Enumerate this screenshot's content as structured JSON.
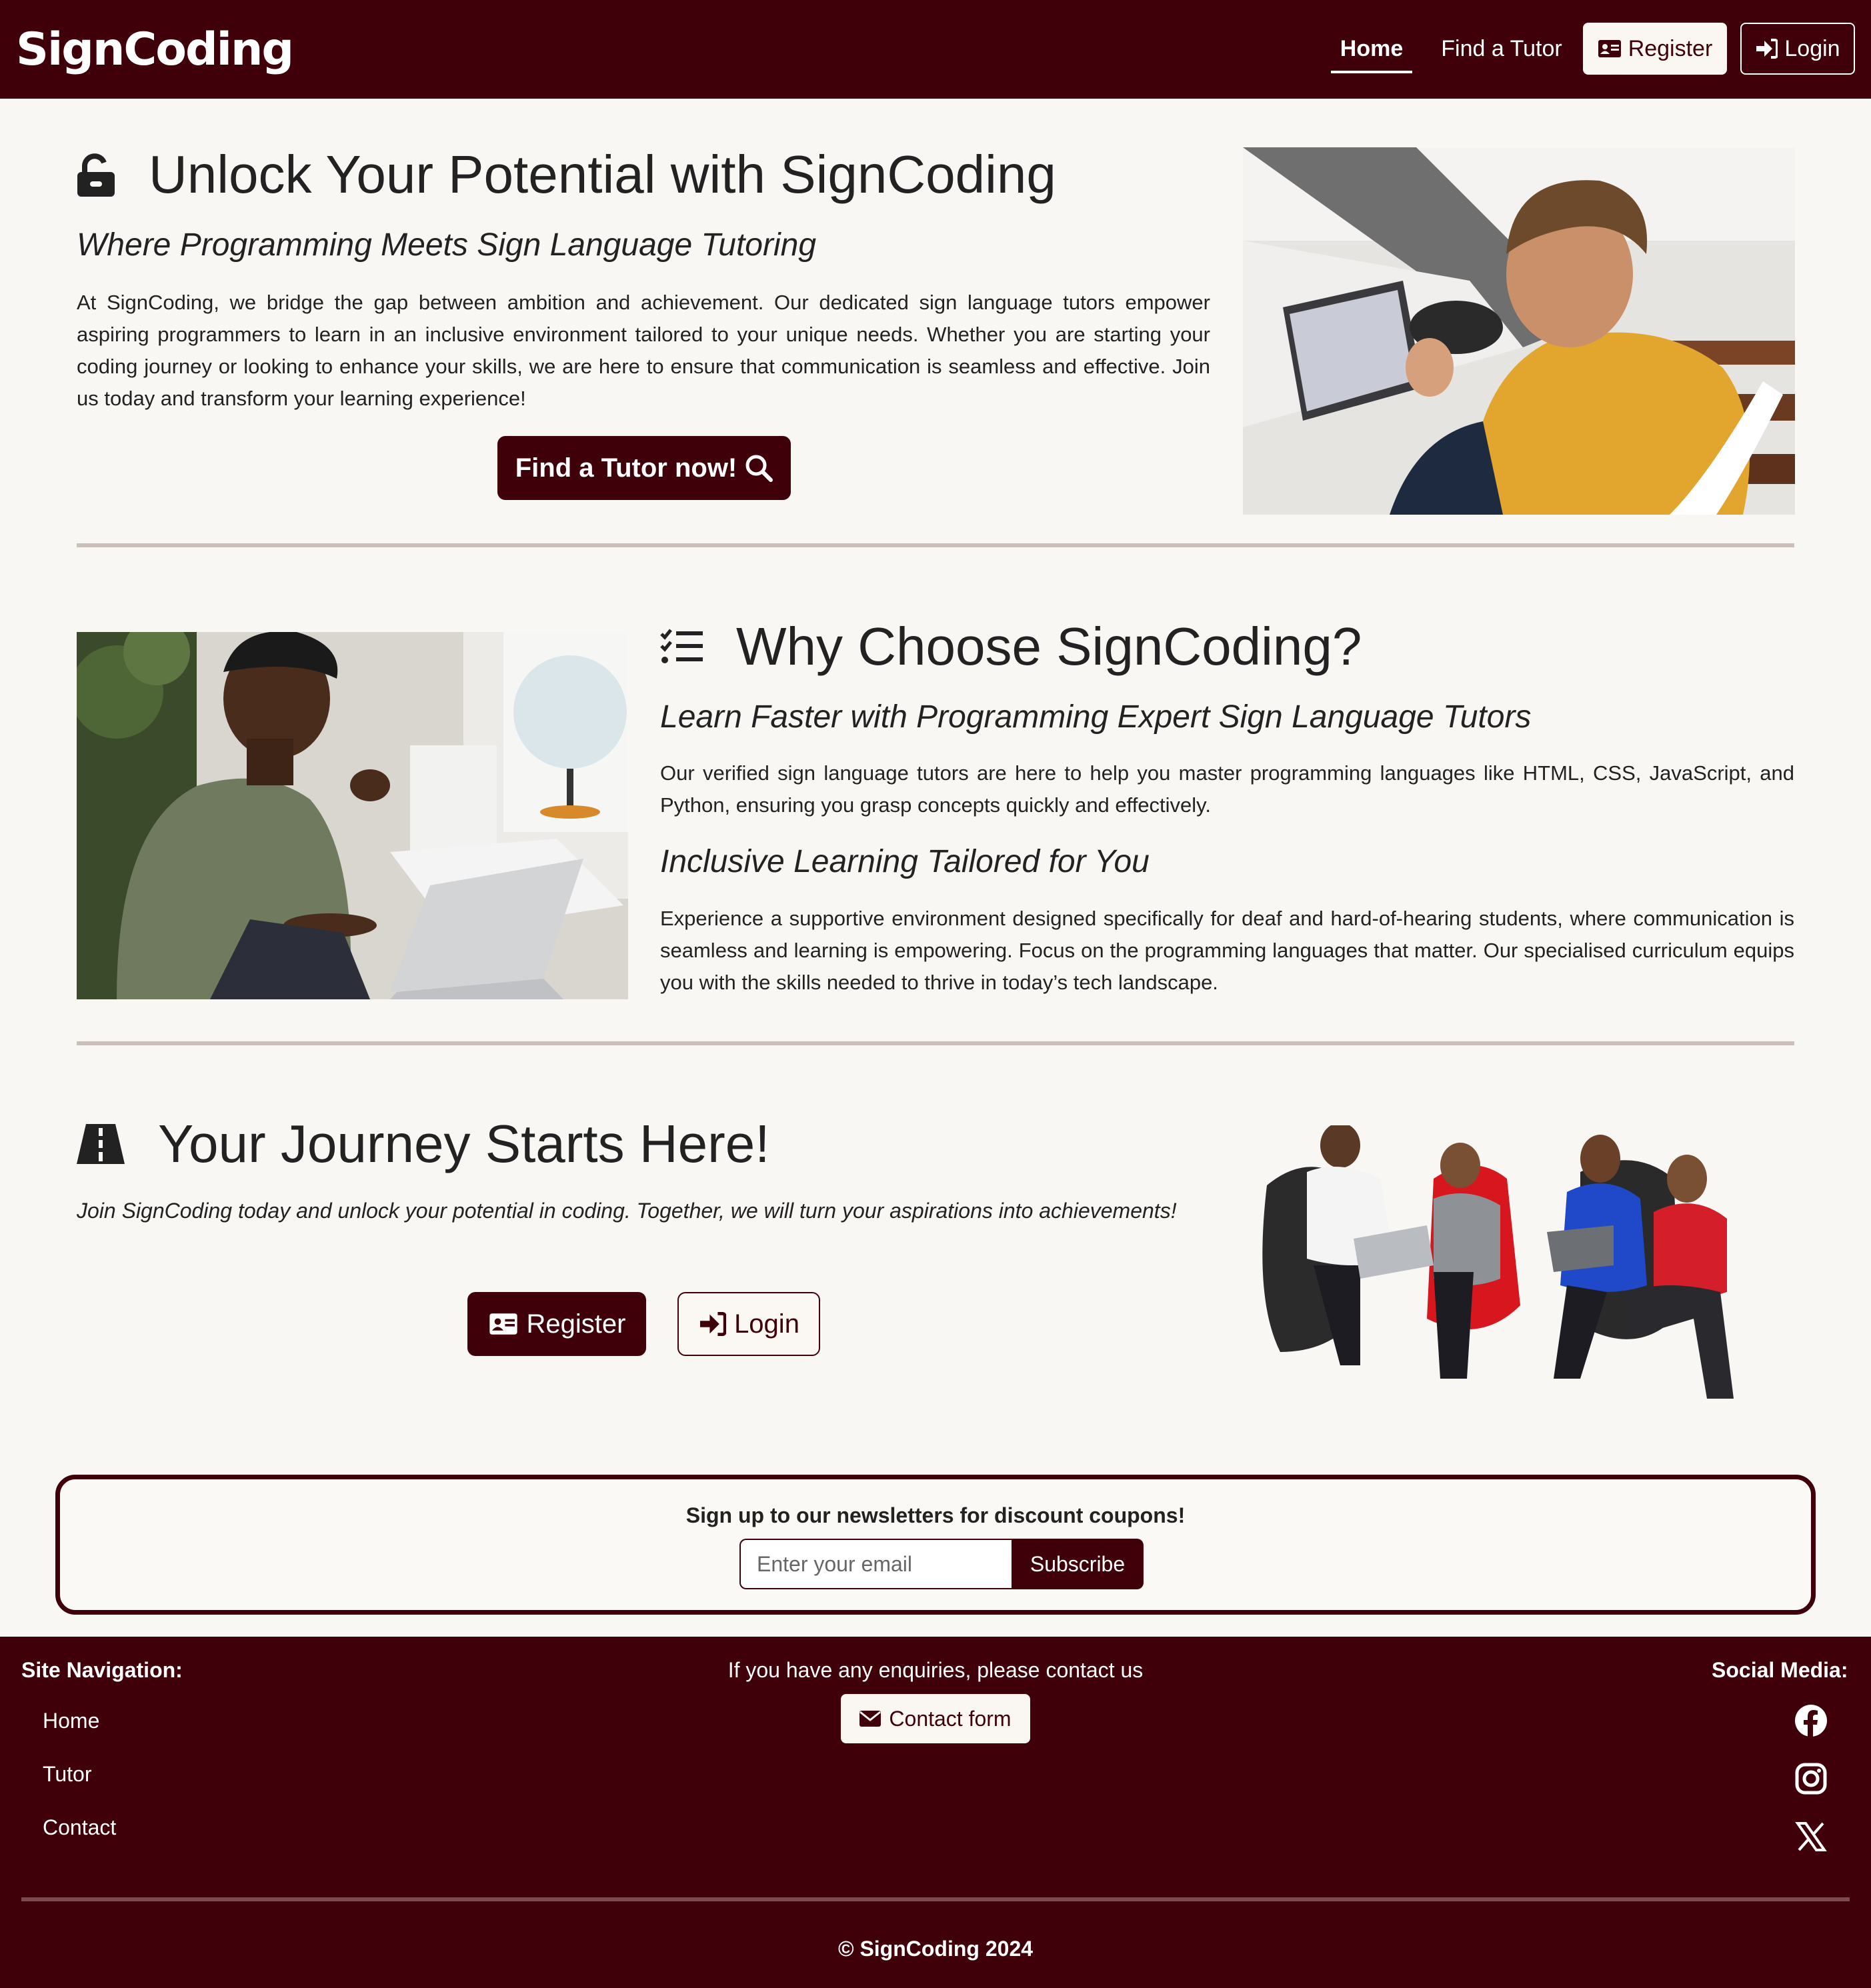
{
  "brand": "SignCoding",
  "nav": {
    "home": "Home",
    "find_tutor": "Find a Tutor",
    "register": "Register",
    "login": "Login"
  },
  "hero": {
    "title": "Unlock Your Potential with SignCoding",
    "subtitle": "Where Programming Meets Sign Language Tutoring",
    "text": "At SignCoding, we bridge the gap between ambition and achievement. Our dedicated sign language tutors empower aspiring programmers to learn in an inclusive environment tailored to your unique needs. Whether you are starting your coding journey or looking to enhance your skills, we are here to ensure that communication is seamless and effective. Join us today and transform your learning experience!",
    "cta": "Find a Tutor now!"
  },
  "why": {
    "title": "Why Choose SignCoding?",
    "sub1": "Learn Faster with Programming Expert Sign Language Tutors",
    "text1": "Our verified sign language tutors are here to help you master programming languages like HTML, CSS, JavaScript, and Python, ensuring you grasp concepts quickly and effectively.",
    "sub2": "Inclusive Learning Tailored for You",
    "text2": "Experience a supportive environment designed specifically for deaf and hard-of-hearing students, where communication is seamless and learning is empowering. Focus on the programming languages that matter. Our specialised curriculum equips you with the skills needed to thrive in today’s tech landscape."
  },
  "journey": {
    "title": "Your Journey Starts Here!",
    "text": "Join SignCoding today and unlock your potential in coding. Together, we will turn your aspirations into achievements!",
    "register": "Register",
    "login": "Login"
  },
  "newsletter": {
    "title": "Sign up to our newsletters for discount coupons!",
    "placeholder": "Enter your email",
    "button": "Subscribe"
  },
  "footer": {
    "nav_heading": "Site Navigation:",
    "nav_items": [
      "Home",
      "Tutor",
      "Contact"
    ],
    "contact_text": "If you have any enquiries, please contact us",
    "contact_button": "Contact form",
    "social_heading": "Social Media:",
    "social": [
      "facebook-icon",
      "instagram-icon",
      "x-icon"
    ],
    "copyright": "© SignCoding 2024"
  },
  "colors": {
    "brand": "#40000a",
    "background": "#f9f7f4",
    "divider": "#cbbfbc"
  }
}
